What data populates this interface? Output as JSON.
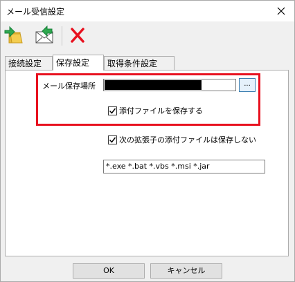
{
  "window": {
    "title": "メール受信設定"
  },
  "toolbar": {
    "icons": [
      "import-folder-icon",
      "mail-icon",
      "delete-icon"
    ],
    "delete_color": "#e8111f"
  },
  "tabs": [
    {
      "label": "接続設定",
      "active": false
    },
    {
      "label": "保存設定",
      "active": true
    },
    {
      "label": "取得条件設定",
      "active": false
    }
  ],
  "save_settings": {
    "location_label": "メール保存場所",
    "browse_label": "...",
    "save_attachments_label": "添付ファイルを保存する",
    "save_attachments_checked": true,
    "exclude_ext_label": "次の拡張子の添付ファイルは保存しない",
    "exclude_ext_checked": true,
    "extensions_value": "*.exe *.bat *.vbs *.msi *.jar"
  },
  "buttons": {
    "ok": "OK",
    "cancel": "キャンセル"
  },
  "colors": {
    "highlight": "#e8111f",
    "accent": "#3c7fb1"
  }
}
